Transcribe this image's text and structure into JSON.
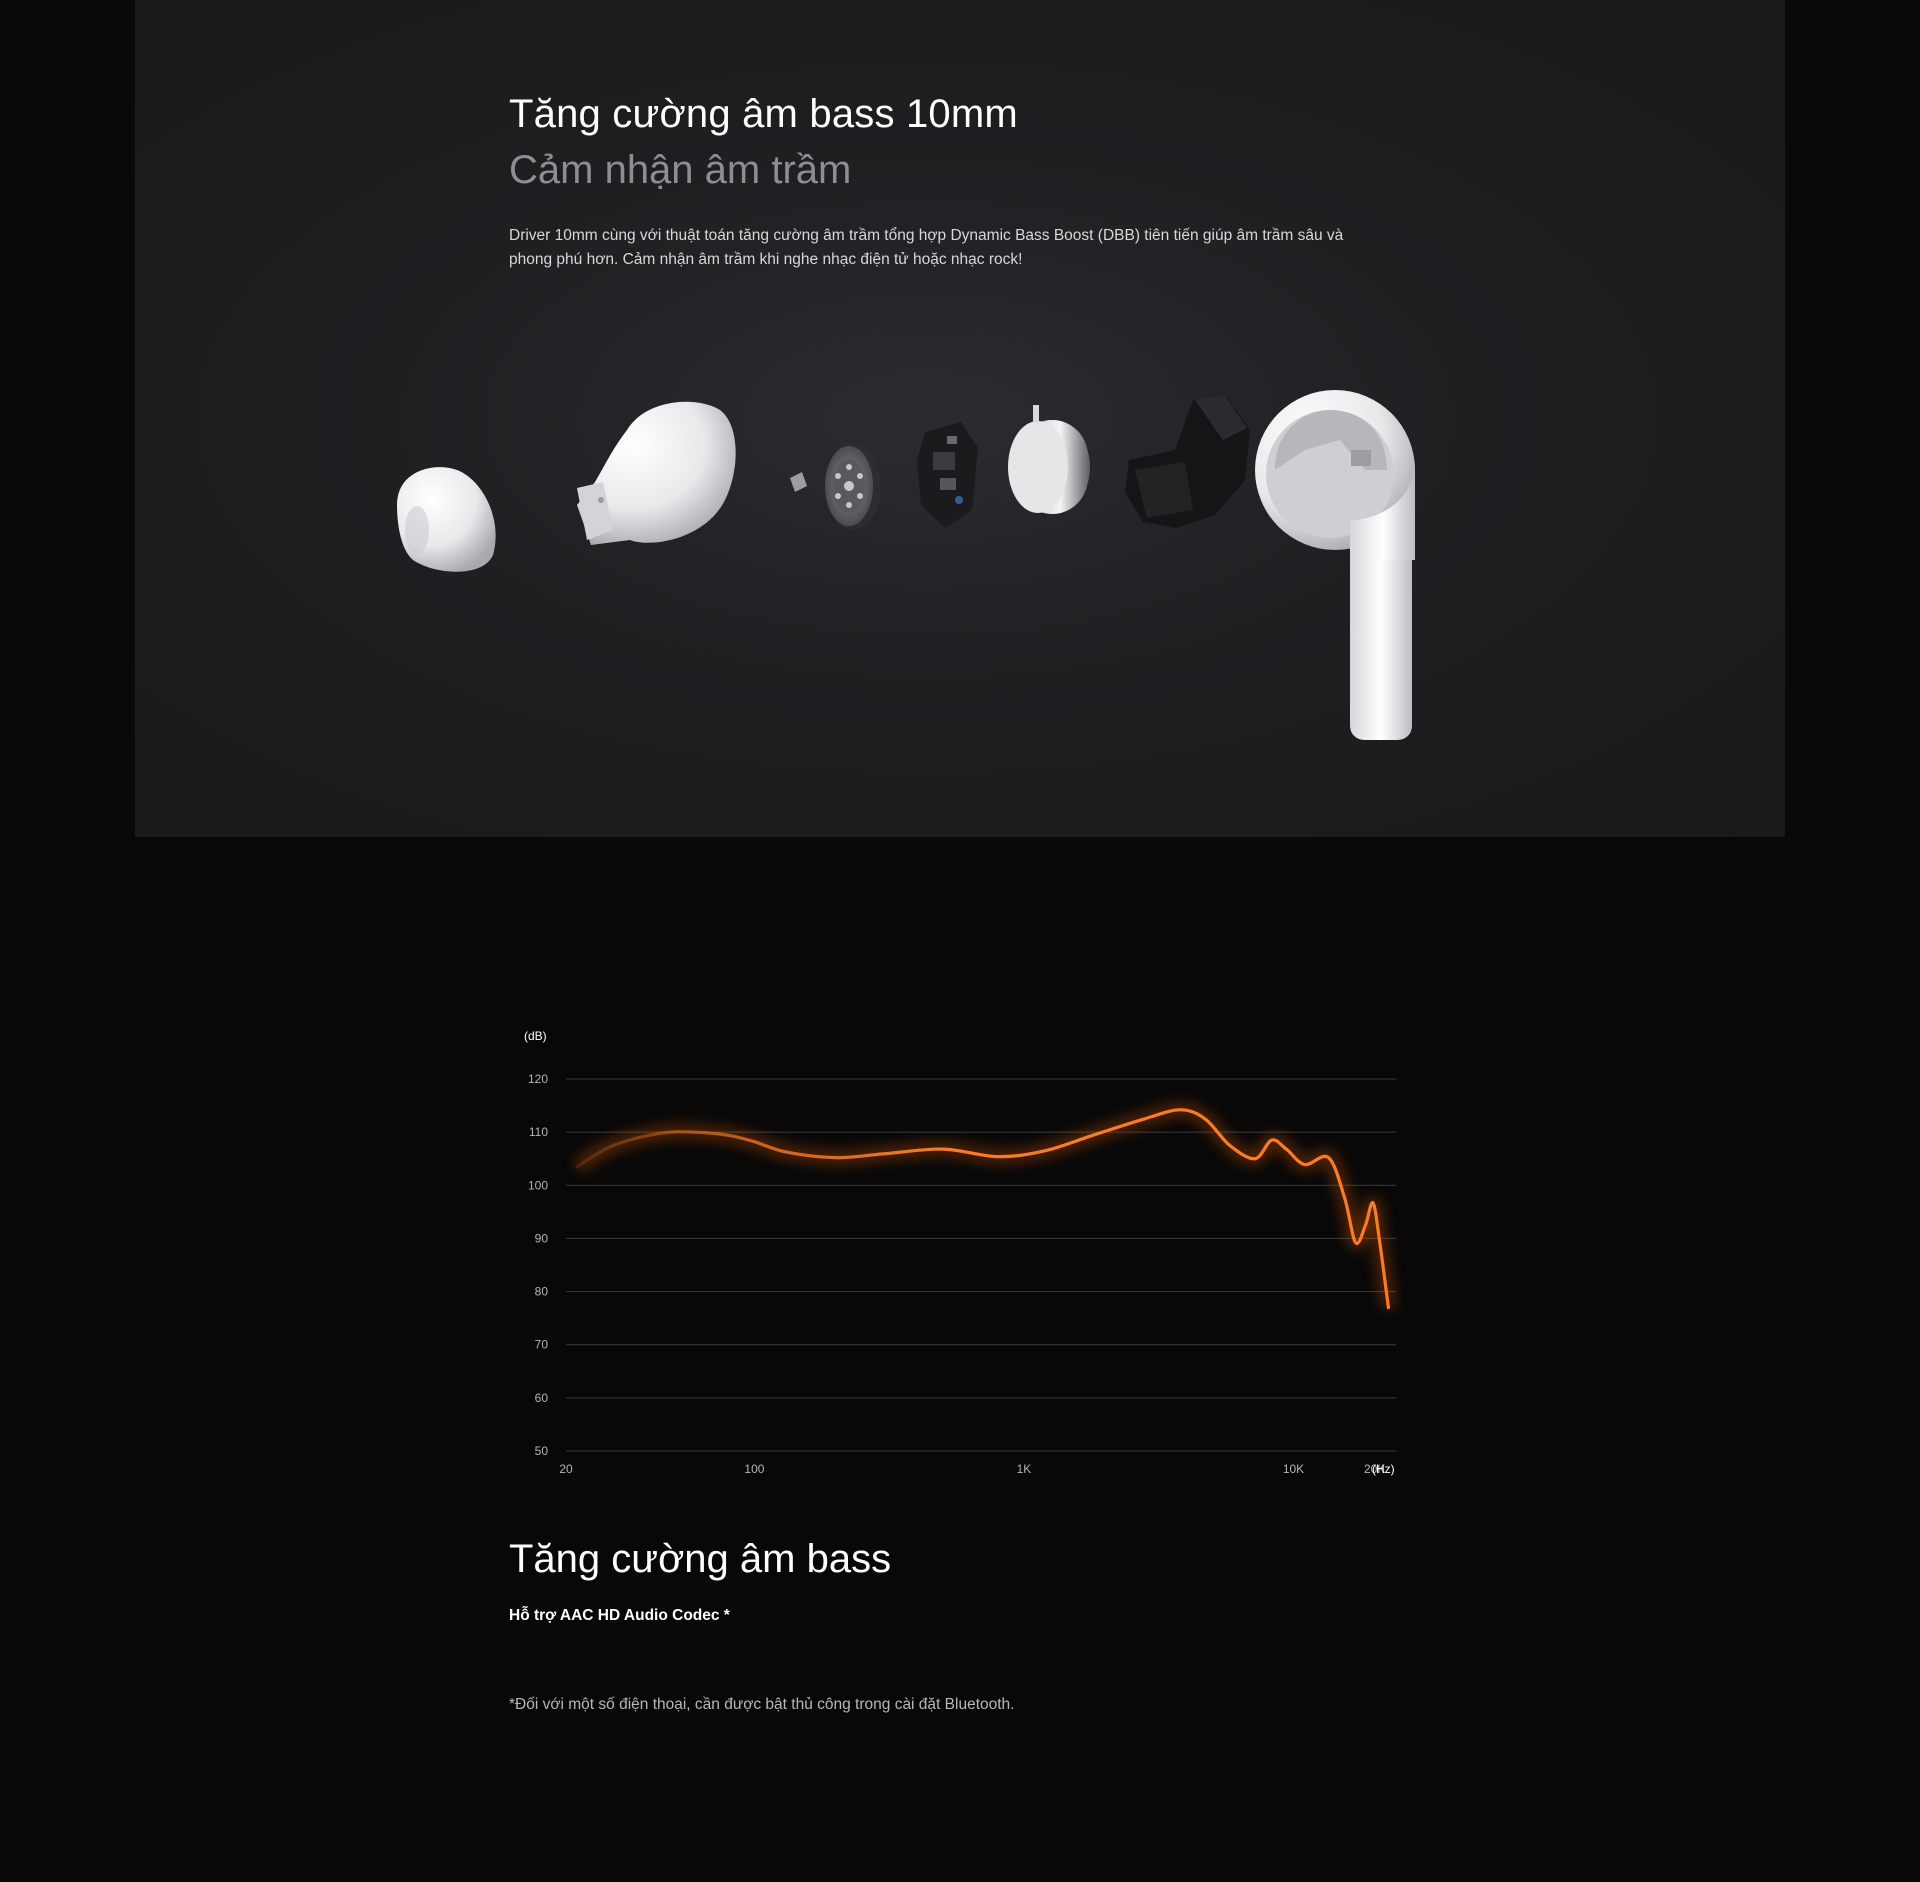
{
  "feature": {
    "title": "Tăng cường âm bass 10mm",
    "subtitle": "Cảm nhận âm trầm",
    "description": "Driver 10mm cùng với thuật toán tăng cường âm trầm tổng hợp Dynamic Bass Boost (DBB) tiên tiến giúp âm trầm sâu và phong phú hơn. Cảm nhận âm trầm khi nghe nhạc điện tử hoặc nhạc rock!",
    "parts": [
      "ear-tip",
      "front-shell",
      "mesh-filter",
      "driver-unit",
      "circuit-board",
      "magnet",
      "bracket",
      "earbud-housing"
    ]
  },
  "chart_data": {
    "type": "line",
    "title": "",
    "xlabel": "(Hz)",
    "ylabel": "(dB)",
    "x_scale": "log",
    "xlim": [
      20,
      24000
    ],
    "ylim": [
      50,
      120
    ],
    "x_ticks": [
      {
        "value": 20,
        "label": "20"
      },
      {
        "value": 100,
        "label": "100"
      },
      {
        "value": 1000,
        "label": "1K"
      },
      {
        "value": 10000,
        "label": "10K"
      },
      {
        "value": 20000,
        "label": "20K"
      }
    ],
    "y_ticks": [
      120,
      110,
      100,
      90,
      80,
      70,
      60,
      50
    ],
    "grid": true,
    "series": [
      {
        "color": "#ff7a1a",
        "x": [
          22,
          30,
          45,
          60,
          80,
          100,
          130,
          200,
          300,
          500,
          800,
          1200,
          1800,
          2800,
          3800,
          4700,
          5800,
          7200,
          8300,
          9400,
          11000,
          13500,
          15500,
          17000,
          18500,
          19700,
          20800,
          22500
        ],
        "y": [
          103.5,
          107.5,
          109.8,
          110,
          109.4,
          108.2,
          106.3,
          105.2,
          105.9,
          106.8,
          105.4,
          106.5,
          109.4,
          112.5,
          114.2,
          112.5,
          107.5,
          105,
          108.5,
          106.8,
          103.9,
          105.2,
          97.5,
          89.2,
          92.5,
          96.7,
          90,
          77
        ]
      }
    ]
  },
  "bass": {
    "title": "Tăng cường âm bass",
    "codec_note": "Hỗ trợ AAC HD Audio Codec *",
    "footnote": "*Đối với một số điện thoại, cần được bật thủ công trong cài đặt Bluetooth."
  }
}
